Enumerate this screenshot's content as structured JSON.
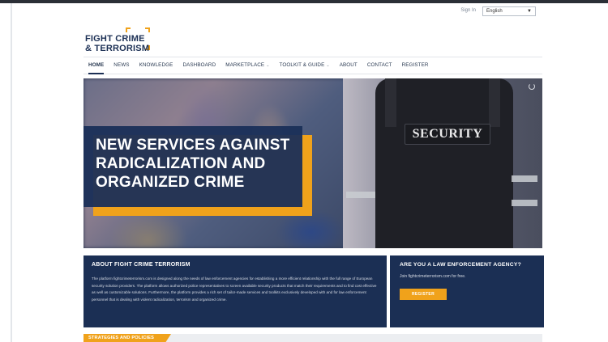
{
  "utility": {
    "signin_label": "Sign In",
    "language_selected": "English"
  },
  "logo": {
    "line1": "FIGHT CRIME",
    "line2": "& TERRORISM"
  },
  "nav": {
    "items": [
      {
        "label": "HOME",
        "active": true
      },
      {
        "label": "NEWS"
      },
      {
        "label": "KNOWLEDGE"
      },
      {
        "label": "DASHBOARD"
      },
      {
        "label": "MARKETPLACE",
        "dropdown": true
      },
      {
        "label": "TOOLKIT & GUIDE",
        "dropdown": true
      },
      {
        "label": "ABOUT"
      },
      {
        "label": "CONTACT"
      },
      {
        "label": "REGISTER"
      }
    ]
  },
  "hero": {
    "title": "NEW SERVICES AGAINST RADICALIZATION AND ORGANIZED CRIME",
    "patch_text": "SECURITY"
  },
  "about": {
    "title": "ABOUT FIGHT CRIME TERRORISM",
    "text": "The platform fightcrimeterrorism.com is designed along the needs of law enforcement agencies for establishing a more efficient relationship with the full range of European security solution providers. The platform allows authorized police representatives to screen available security products that match their requirements and to find cost effective as well as customizable solutions. Furthermore, the platform provides a rich set of tailor-made services and toolkits exclusively developed with and for law enforcement personnel that is dealing with violent radicalization, terrorism and organized crime."
  },
  "lea": {
    "title": "ARE YOU A LAW ENFORCEMENT AGENCY?",
    "text": "Join fightcrimeterrorism.com for free.",
    "button": "REGISTER"
  },
  "strategies": {
    "label": "STRATEGIES AND POLICIES"
  },
  "colors": {
    "navy": "#1b2f54",
    "accent": "#f0a21b"
  }
}
